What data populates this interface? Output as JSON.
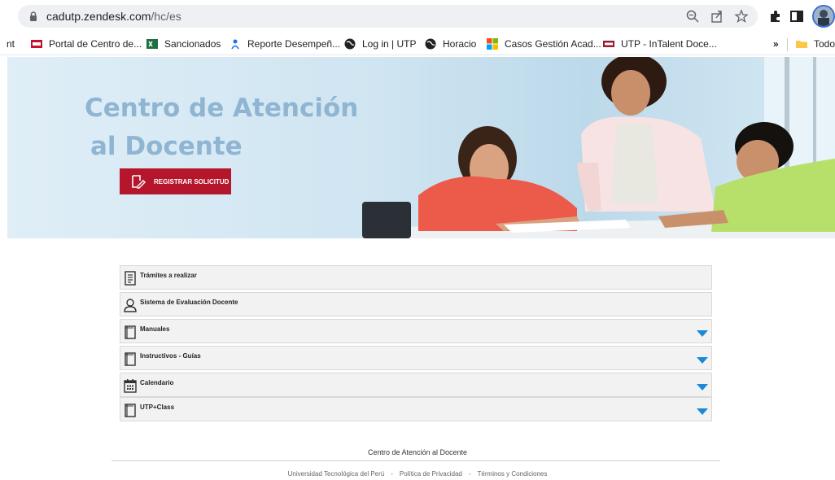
{
  "browser": {
    "url_host": "cadutp.zendesk.com",
    "url_path": "/hc/es",
    "bookmarks": [
      {
        "label": "nt",
        "icon": "truncated"
      },
      {
        "label": "Portal de Centro de...",
        "icon": "utp-red-icon"
      },
      {
        "label": "Sancionados",
        "icon": "excel-icon"
      },
      {
        "label": "Reporte Desempeñ...",
        "icon": "person-icon"
      },
      {
        "label": "Log in | UTP",
        "icon": "globe-icon"
      },
      {
        "label": "Horacio",
        "icon": "globe-icon"
      },
      {
        "label": "Casos Gestión Acad...",
        "icon": "microsoft-icon"
      },
      {
        "label": "UTP - InTalent Doce...",
        "icon": "utp-icon"
      }
    ],
    "overflow": "»",
    "folder_label": "Todo"
  },
  "banner": {
    "title_line1": "Centro de Atención",
    "title_line2": "al Docente",
    "button_label": "REGISTRAR SOLICITUD"
  },
  "sections": [
    {
      "label": "Trámites a realizar",
      "icon": "document-list-icon",
      "expandable": false
    },
    {
      "label": "Sistema de Evaluación Docente",
      "icon": "user-icon",
      "expandable": false
    },
    {
      "label": "Manuales",
      "icon": "book-icon",
      "expandable": true
    },
    {
      "label": "Instructivos - Guías",
      "icon": "book-icon",
      "expandable": true
    },
    {
      "label": "Calendario",
      "icon": "calendar-icon",
      "expandable": true
    },
    {
      "label": "UTP+Class",
      "icon": "book-icon",
      "expandable": true
    }
  ],
  "footer": {
    "title": "Centro de Atención al Docente",
    "links": [
      "Universidad Tecnológica del Perú",
      "Política de Privacidad",
      "Términos y Condiciones"
    ],
    "separator": "-"
  },
  "colors": {
    "accent_red": "#b5162c",
    "caret_blue": "#1e88d6",
    "title_blue": "#8fb5d3"
  }
}
